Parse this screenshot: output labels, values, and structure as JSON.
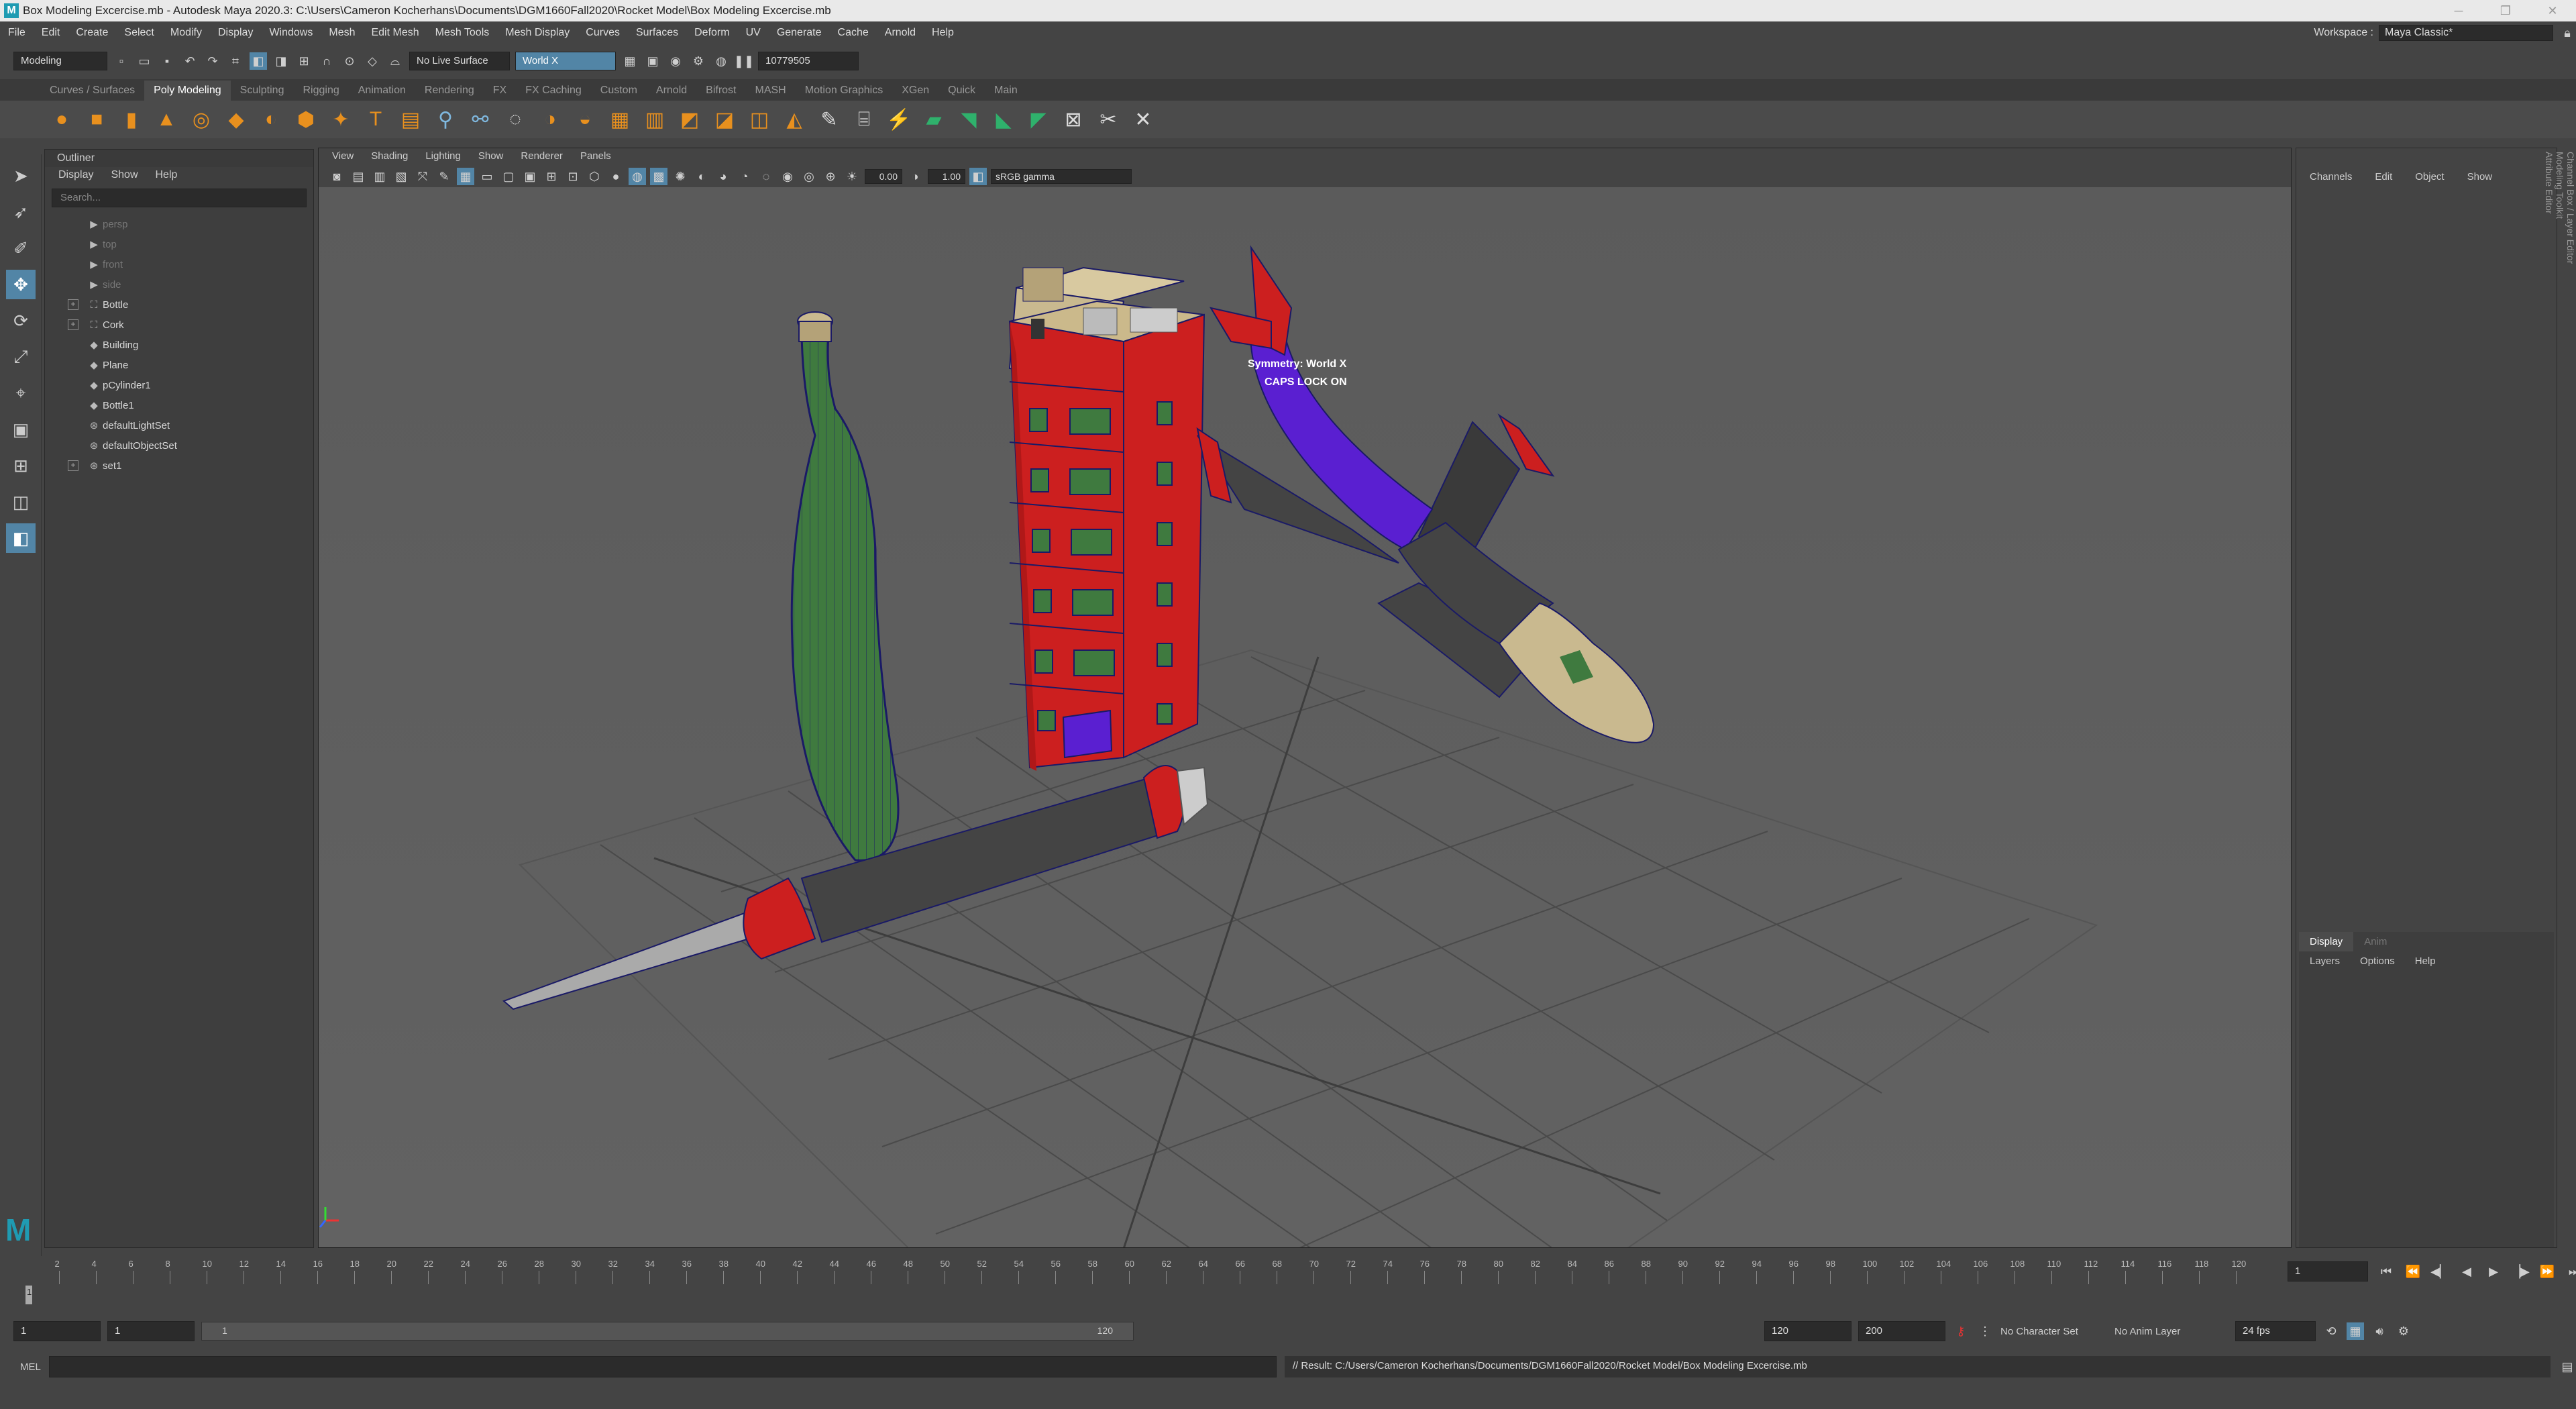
{
  "window": {
    "title": "Box Modeling Excercise.mb - Autodesk Maya 2020.3: C:\\Users\\Cameron Kocherhans\\Documents\\DGM1660Fall2020\\Rocket Model\\Box Modeling Excercise.mb"
  },
  "menus": [
    "File",
    "Edit",
    "Create",
    "Select",
    "Modify",
    "Display",
    "Windows",
    "Mesh",
    "Edit Mesh",
    "Mesh Tools",
    "Mesh Display",
    "Curves",
    "Surfaces",
    "Deform",
    "UV",
    "Generate",
    "Cache",
    "Arnold",
    "Help"
  ],
  "workspace": {
    "label": "Workspace :",
    "value": "Maya Classic*"
  },
  "status_line": {
    "mode": "Modeling",
    "live_surface": "No Live Surface",
    "symmetry": "World X",
    "sn_field": "10779505"
  },
  "shelf_tabs": [
    "Curves / Surfaces",
    "Poly Modeling",
    "Sculpting",
    "Rigging",
    "Animation",
    "Rendering",
    "FX",
    "FX Caching",
    "Custom",
    "Arnold",
    "Bifrost",
    "MASH",
    "Motion Graphics",
    "XGen",
    "Quick",
    "Main"
  ],
  "shelf_active": "Poly Modeling",
  "outliner": {
    "title": "Outliner",
    "menu": [
      "Display",
      "Show",
      "Help"
    ],
    "search_placeholder": "Search...",
    "items": [
      {
        "label": "persp",
        "icon": "camera-icon",
        "dim": true,
        "expandable": false
      },
      {
        "label": "top",
        "icon": "camera-icon",
        "dim": true,
        "expandable": false
      },
      {
        "label": "front",
        "icon": "camera-icon",
        "dim": true,
        "expandable": false
      },
      {
        "label": "side",
        "icon": "camera-icon",
        "dim": true,
        "expandable": false
      },
      {
        "label": "Bottle",
        "icon": "transform-icon",
        "dim": false,
        "expandable": true
      },
      {
        "label": "Cork",
        "icon": "transform-icon",
        "dim": false,
        "expandable": true
      },
      {
        "label": "Building",
        "icon": "mesh-icon",
        "dim": false,
        "expandable": false
      },
      {
        "label": "Plane",
        "icon": "mesh-icon",
        "dim": false,
        "expandable": false
      },
      {
        "label": "pCylinder1",
        "icon": "mesh-icon",
        "dim": false,
        "expandable": false
      },
      {
        "label": "Bottle1",
        "icon": "mesh-icon",
        "dim": false,
        "expandable": false
      },
      {
        "label": "defaultLightSet",
        "icon": "set-icon",
        "dim": false,
        "expandable": false
      },
      {
        "label": "defaultObjectSet",
        "icon": "set-icon",
        "dim": false,
        "expandable": false
      },
      {
        "label": "set1",
        "icon": "set-icon",
        "dim": false,
        "expandable": true
      }
    ]
  },
  "viewport": {
    "menu": [
      "View",
      "Shading",
      "Lighting",
      "Show",
      "Renderer",
      "Panels"
    ],
    "exposure": "0.00",
    "gamma": "1.00",
    "color_space": "sRGB gamma",
    "hud_symmetry": "Symmetry: World X",
    "hud_caps": "CAPS LOCK ON",
    "camera": "persp"
  },
  "channel_box": {
    "menu": [
      "Channels",
      "Edit",
      "Object",
      "Show"
    ]
  },
  "layer_editor": {
    "tabs": [
      "Display",
      "Anim"
    ],
    "menu": [
      "Layers",
      "Options",
      "Help"
    ]
  },
  "side_tabs": [
    "Channel Box / Layer Editor",
    "Modeling Toolkit",
    "Attribute Editor"
  ],
  "time_slider": {
    "ticks": [
      2,
      4,
      6,
      8,
      10,
      12,
      14,
      16,
      18,
      20,
      22,
      24,
      26,
      28,
      30,
      32,
      34,
      36,
      38,
      40,
      42,
      44,
      46,
      48,
      50,
      52,
      54,
      56,
      58,
      60,
      62,
      64,
      66,
      68,
      70,
      72,
      74,
      76,
      78,
      80,
      82,
      84,
      86,
      88,
      90,
      92,
      94,
      96,
      98,
      100,
      102,
      104,
      106,
      108,
      110,
      112,
      114,
      116,
      118,
      120
    ],
    "current_frame": "1",
    "current_frame_field": "1"
  },
  "range": {
    "start": "1",
    "playback_start": "1",
    "slider_start": "1",
    "slider_end": "120",
    "playback_end": "120",
    "end": "200",
    "character_set": "No Character Set",
    "anim_layer": "No Anim Layer",
    "fps": "24 fps"
  },
  "command_line": {
    "label": "MEL",
    "result": "// Result: C:/Users/Cameron Kocherhans/Documents/DGM1660Fall2020/Rocket Model/Box Modeling Excercise.mb"
  },
  "colors": {
    "accent": "#5285a6",
    "shelf_orange": "#e8901e",
    "building_red": "#cc1f1f",
    "bottle_green": "#3f7a3f",
    "plane_purple": "#5a1fd1",
    "mesh_wire": "#1a1a66"
  }
}
